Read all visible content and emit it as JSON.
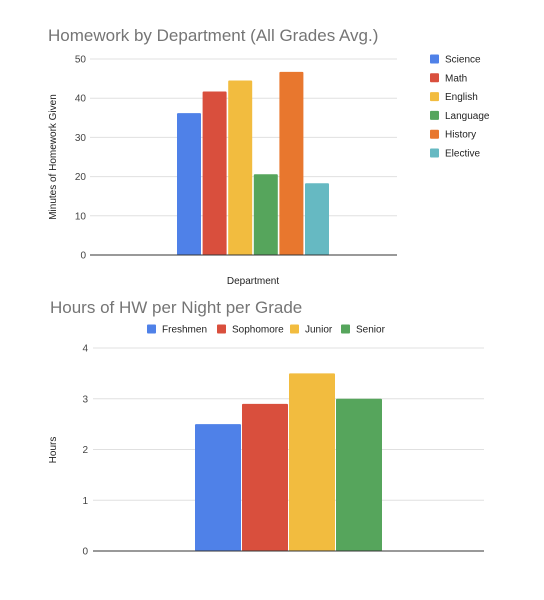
{
  "chart_data": [
    {
      "type": "bar",
      "title": "Homework by Department (All Grades Avg.)",
      "xlabel": "Department",
      "ylabel": "Minutes of Homework Given",
      "ylim": [
        0,
        50
      ],
      "yticks": [
        0,
        10,
        20,
        30,
        40,
        50
      ],
      "grid": true,
      "legend_position": "right",
      "categories": [
        ""
      ],
      "series": [
        {
          "name": "Science",
          "values": [
            36.2
          ],
          "color": "#4f81e8"
        },
        {
          "name": "Math",
          "values": [
            41.7
          ],
          "color": "#d94f3d"
        },
        {
          "name": "English",
          "values": [
            44.5
          ],
          "color": "#f2bc3f"
        },
        {
          "name": "Language",
          "values": [
            20.6
          ],
          "color": "#56a55c"
        },
        {
          "name": "History",
          "values": [
            46.7
          ],
          "color": "#e8772e"
        },
        {
          "name": "Elective",
          "values": [
            18.3
          ],
          "color": "#66b9c2"
        }
      ]
    },
    {
      "type": "bar",
      "title": "Hours of HW per Night per Grade",
      "xlabel": "",
      "ylabel": "Hours",
      "ylim": [
        0,
        4
      ],
      "yticks": [
        0,
        1,
        2,
        3,
        4
      ],
      "grid": true,
      "legend_position": "top",
      "categories": [
        ""
      ],
      "series": [
        {
          "name": "Freshmen",
          "values": [
            2.5
          ],
          "color": "#4f81e8"
        },
        {
          "name": "Sophomore",
          "values": [
            2.9
          ],
          "color": "#d94f3d"
        },
        {
          "name": "Junior",
          "values": [
            3.5
          ],
          "color": "#f2bc3f"
        },
        {
          "name": "Senior",
          "values": [
            3.0
          ],
          "color": "#56a55c"
        }
      ]
    }
  ]
}
